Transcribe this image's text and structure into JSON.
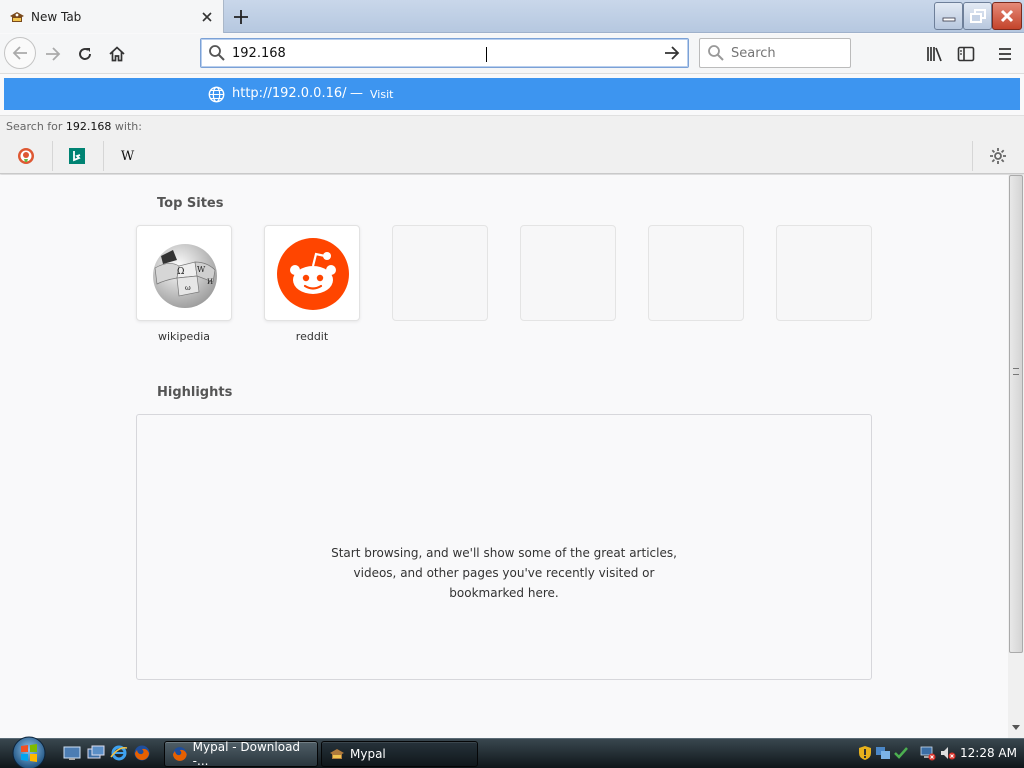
{
  "browser": {
    "tab": {
      "title": "New Tab"
    },
    "urlbar": {
      "value": "192.168",
      "placeholder": ""
    },
    "searchbar": {
      "placeholder": "Search"
    },
    "suggestion": {
      "url": "http://192.0.0.16/",
      "separator": "—",
      "action": "Visit"
    },
    "search_for": {
      "prefix": "Search for",
      "query": "192.168",
      "suffix": "with:"
    },
    "engines": [
      {
        "name": "DuckDuckGo",
        "icon": "duckduckgo-icon"
      },
      {
        "name": "Bing",
        "icon": "bing-icon"
      },
      {
        "name": "Wikipedia",
        "icon": "wikipedia-icon",
        "glyph": "W"
      }
    ]
  },
  "newtab": {
    "top_sites_title": "Top Sites",
    "top_sites": [
      {
        "label": "wikipedia"
      },
      {
        "label": "reddit"
      },
      {
        "label": ""
      },
      {
        "label": ""
      },
      {
        "label": ""
      },
      {
        "label": ""
      }
    ],
    "highlights_title": "Highlights",
    "highlights_empty": {
      "line1": "Start browsing, and we'll show some of the great articles,",
      "line2": "videos, and other pages you've recently visited or",
      "line3": "bookmarked here."
    }
  },
  "taskbar": {
    "tasks": [
      {
        "label": "Mypal - Download -..."
      },
      {
        "label": "Mypal"
      }
    ],
    "clock": "12:28 AM"
  },
  "colors": {
    "suggestion_bg": "#3d95f0",
    "reddit": "#ff4500",
    "taskbar": "#1b252b"
  }
}
